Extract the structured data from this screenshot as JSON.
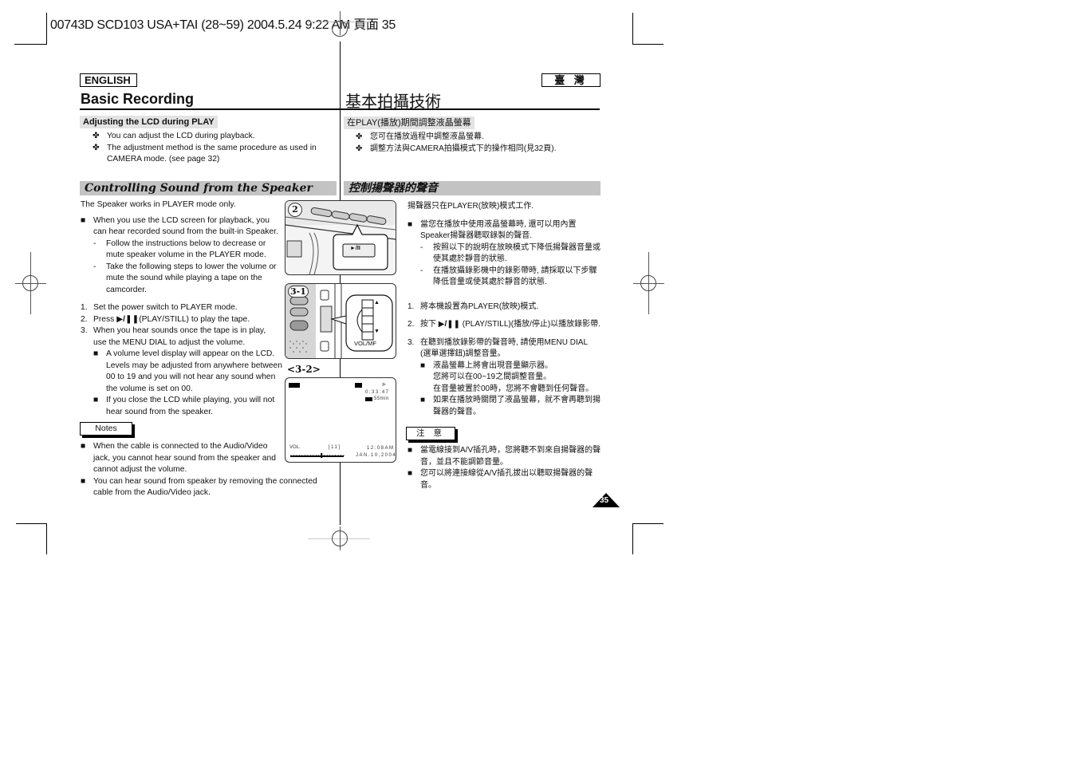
{
  "slug": "00743D SCD103 USA+TAI (28~59) 2004.5.24  9:22 AM 頁面 35",
  "left": {
    "language": "ENGLISH",
    "title": "Basic Recording",
    "section1": {
      "heading": "Adjusting the LCD during PLAY",
      "bullets": [
        "You can adjust the LCD during playback.",
        "The adjustment method is the same procedure as used in",
        "CAMERA mode. (see page 32)"
      ],
      "marker": "✤"
    },
    "section2": {
      "heading": "Controlling Sound from the Speaker",
      "intro": "The Speaker works in PLAYER mode only.",
      "bullet1": [
        "When you use the LCD screen for playback, you",
        "can hear recorded sound from the built-in Speaker."
      ],
      "dash1": [
        "Follow the instructions below to decrease or",
        "mute speaker volume in the PLAYER mode."
      ],
      "dash2": [
        "Take the following steps to lower the volume or",
        "mute the sound while playing a tape on the",
        "camcorder."
      ],
      "steps": [
        {
          "n": "1.",
          "text": "Set the power switch to PLAYER mode."
        },
        {
          "n": "2.",
          "pre": "Press ",
          "icon": "▶/❚❚",
          "text": "(PLAY/STILL) to play the tape."
        },
        {
          "n": "3.",
          "text": "When you hear sounds once the tape is in play,",
          "text2": "use the MENU DIAL to adjust the volume."
        }
      ],
      "sub1": [
        "A volume level display will appear on the LCD.",
        "Levels may be adjusted from anywhere between",
        "00 to 19 and you will not hear any sound when",
        "the volume is set on 00."
      ],
      "sub2": [
        "If you close the LCD while playing, you will not",
        "hear sound from the speaker."
      ],
      "notes_label": "Notes",
      "notes": [
        [
          "When the cable is connected to the Audio/Video",
          "jack, you cannot hear sound from the speaker and",
          "cannot adjust the volume."
        ],
        [
          "You can hear sound from speaker by removing the connected",
          "cable from the Audio/Video jack."
        ]
      ],
      "square": "■",
      "dash": "-"
    }
  },
  "figures": {
    "fig2": {
      "label": "2",
      "button": "►/II"
    },
    "fig31": {
      "label": "3-1",
      "dial_label": "VOL/MF",
      "up": "▲",
      "down": "▼"
    },
    "fig32": {
      "label": "<3-2>",
      "counter": "0:33:47",
      "remain": "55min",
      "vol_label": "VOL.",
      "vol_value": "[11]",
      "time": "12:08AM",
      "date": "JAN.10,2004",
      "volume_level": 11,
      "volume_max": 19,
      "play_icon": "►"
    }
  },
  "right": {
    "language": "臺 灣",
    "title": "基本拍攝技術",
    "section1": {
      "heading": "在PLAY(播放)期間調整液晶螢幕",
      "bullets": [
        "您可在播放過程中調整液晶螢幕.",
        "調整方法與CAMERA拍攝模式下的操作相同(見32頁)."
      ]
    },
    "section2": {
      "heading": "控制揚聲器的聲音",
      "intro": "揚聲器只在PLAYER(放映)模式工作.",
      "bullet1": [
        "當您在播放中使用液晶螢幕時, 還可以用內置",
        "Speaker揚聲器聽取錄製的聲音."
      ],
      "dash1": [
        "按照以下的說明在放映模式下降低揚聲器音量或",
        "使其處於靜音的狀態."
      ],
      "dash2": [
        "在播放攝錄影機中的錄影帶時, 請採取以下步驟",
        "降低音量或使其處於靜音的狀態."
      ],
      "steps": [
        {
          "n": "1.",
          "text": "將本機設置為PLAYER(放映)模式."
        },
        {
          "n": "2.",
          "pre": "按下 ",
          "icon": "▶/❚❚",
          "text": " (PLAY/STILL)(播放/停止)以播放錄影帶."
        },
        {
          "n": "3.",
          "text": "在聽到播放錄影帶的聲音時, 請使用MENU DIAL",
          "text2": "(選單選擇鈕)調整音量。"
        }
      ],
      "sub1": [
        "液晶螢幕上將會出現音量顯示器。",
        "您將可以在00~19之間調整音量。",
        "在音量被置於00時，您將不會聽到任何聲音。"
      ],
      "sub2": [
        "如果在播放時關閉了液晶螢幕，就不會再聽到揚",
        "聲器的聲音。"
      ],
      "notes_label": "注 意",
      "notes": [
        [
          "當電線接到A/V插孔時，您將聽不到來自揚聲器的聲",
          "音，並且不能調節音量。"
        ],
        [
          "您可以將連接線從A/V插孔拔出以聽取揚聲器的聲",
          "音。"
        ]
      ]
    }
  },
  "page_number": "35"
}
